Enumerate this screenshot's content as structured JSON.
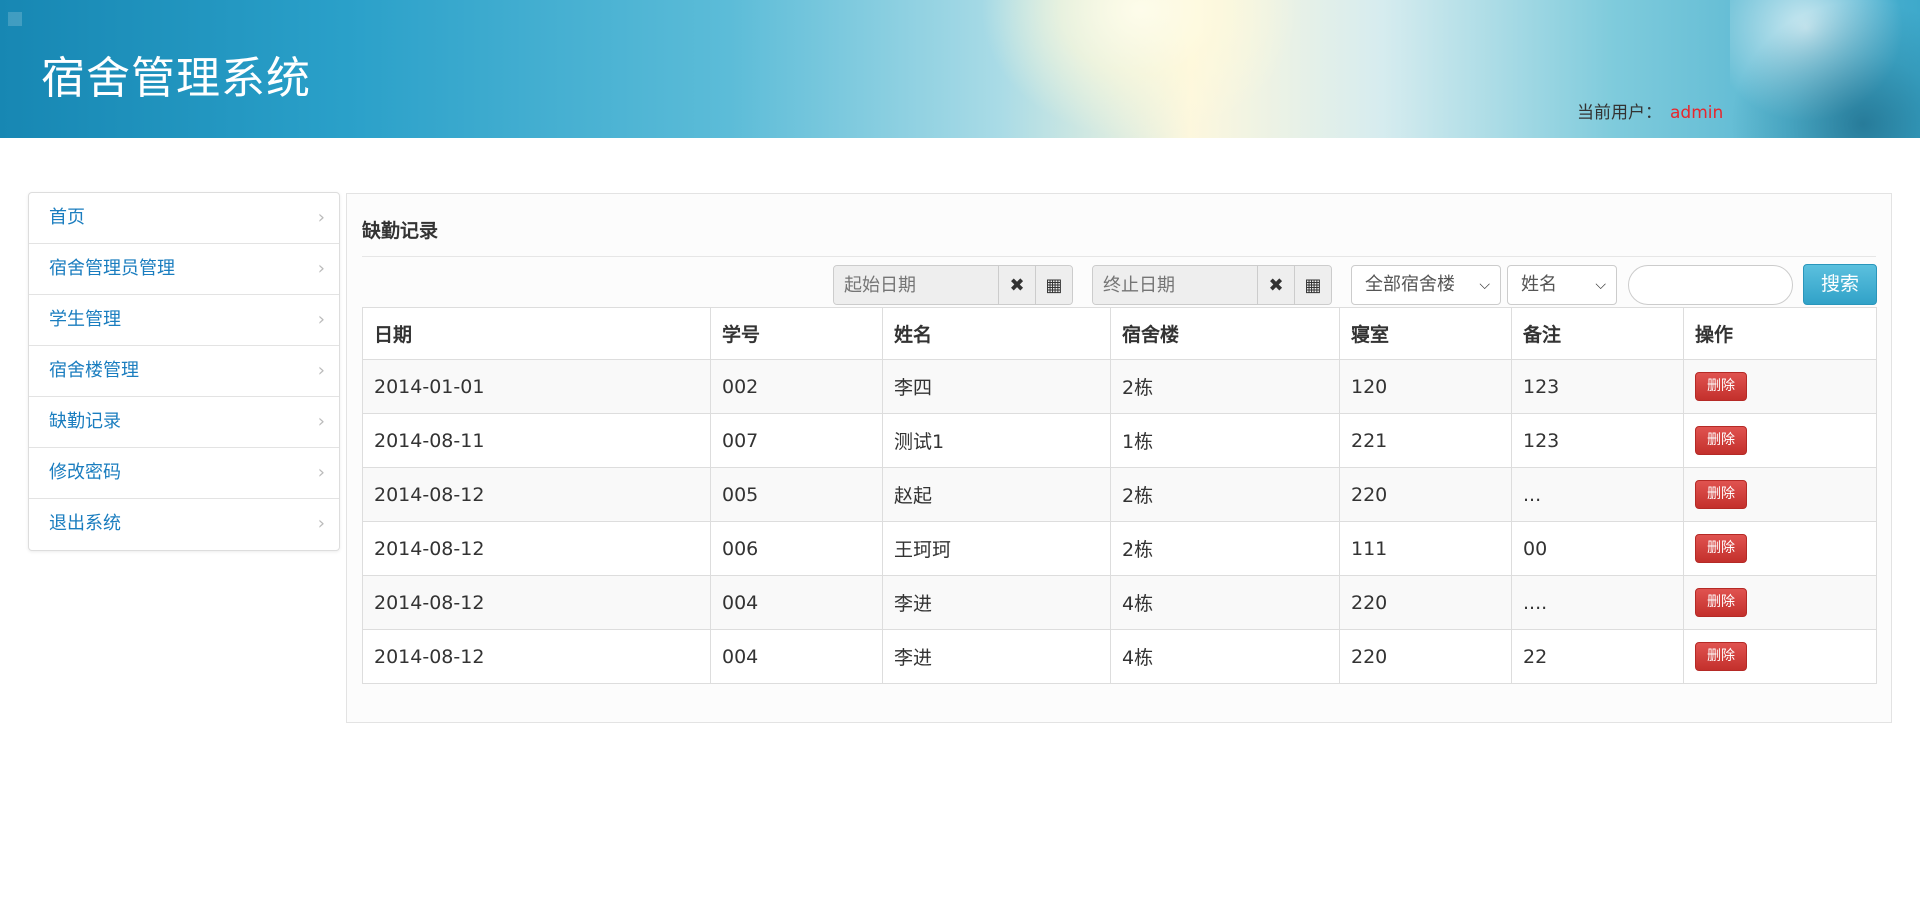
{
  "header": {
    "title": "宿舍管理系统",
    "user_label": "当前用户：",
    "user_name": "admin"
  },
  "sidebar": {
    "items": [
      {
        "label": "首页"
      },
      {
        "label": "宿舍管理员管理"
      },
      {
        "label": "学生管理"
      },
      {
        "label": "宿舍楼管理"
      },
      {
        "label": "缺勤记录"
      },
      {
        "label": "修改密码"
      },
      {
        "label": "退出系统"
      }
    ],
    "chevron": "›"
  },
  "main": {
    "title": "缺勤记录",
    "toolbar": {
      "start_date_placeholder": "起始日期",
      "end_date_placeholder": "终止日期",
      "clear_glyph": "✖",
      "calendar_glyph": "▦",
      "building_select": "全部宿舍楼",
      "field_select": "姓名",
      "search_value": "",
      "search_label": "搜索"
    },
    "table": {
      "headers": [
        "日期",
        "学号",
        "姓名",
        "宿舍楼",
        "寝室",
        "备注",
        "操作"
      ],
      "rows": [
        [
          "2014-01-01",
          "002",
          "李四",
          "2栋",
          "120",
          "123"
        ],
        [
          "2014-08-11",
          "007",
          "测试1",
          "1栋",
          "221",
          "123"
        ],
        [
          "2014-08-12",
          "005",
          "赵起",
          "2栋",
          "220",
          "..."
        ],
        [
          "2014-08-12",
          "006",
          "王珂珂",
          "2栋",
          "111",
          "00"
        ],
        [
          "2014-08-12",
          "004",
          "李进",
          "4栋",
          "220",
          "...."
        ],
        [
          "2014-08-12",
          "004",
          "李进",
          "4栋",
          "220",
          "22"
        ]
      ],
      "delete_label": "删除"
    }
  },
  "colors": {
    "link": "#1a7dbf",
    "user_name": "#e8262c",
    "search_button": "#31a2c8",
    "delete_button": "#c9302c"
  }
}
